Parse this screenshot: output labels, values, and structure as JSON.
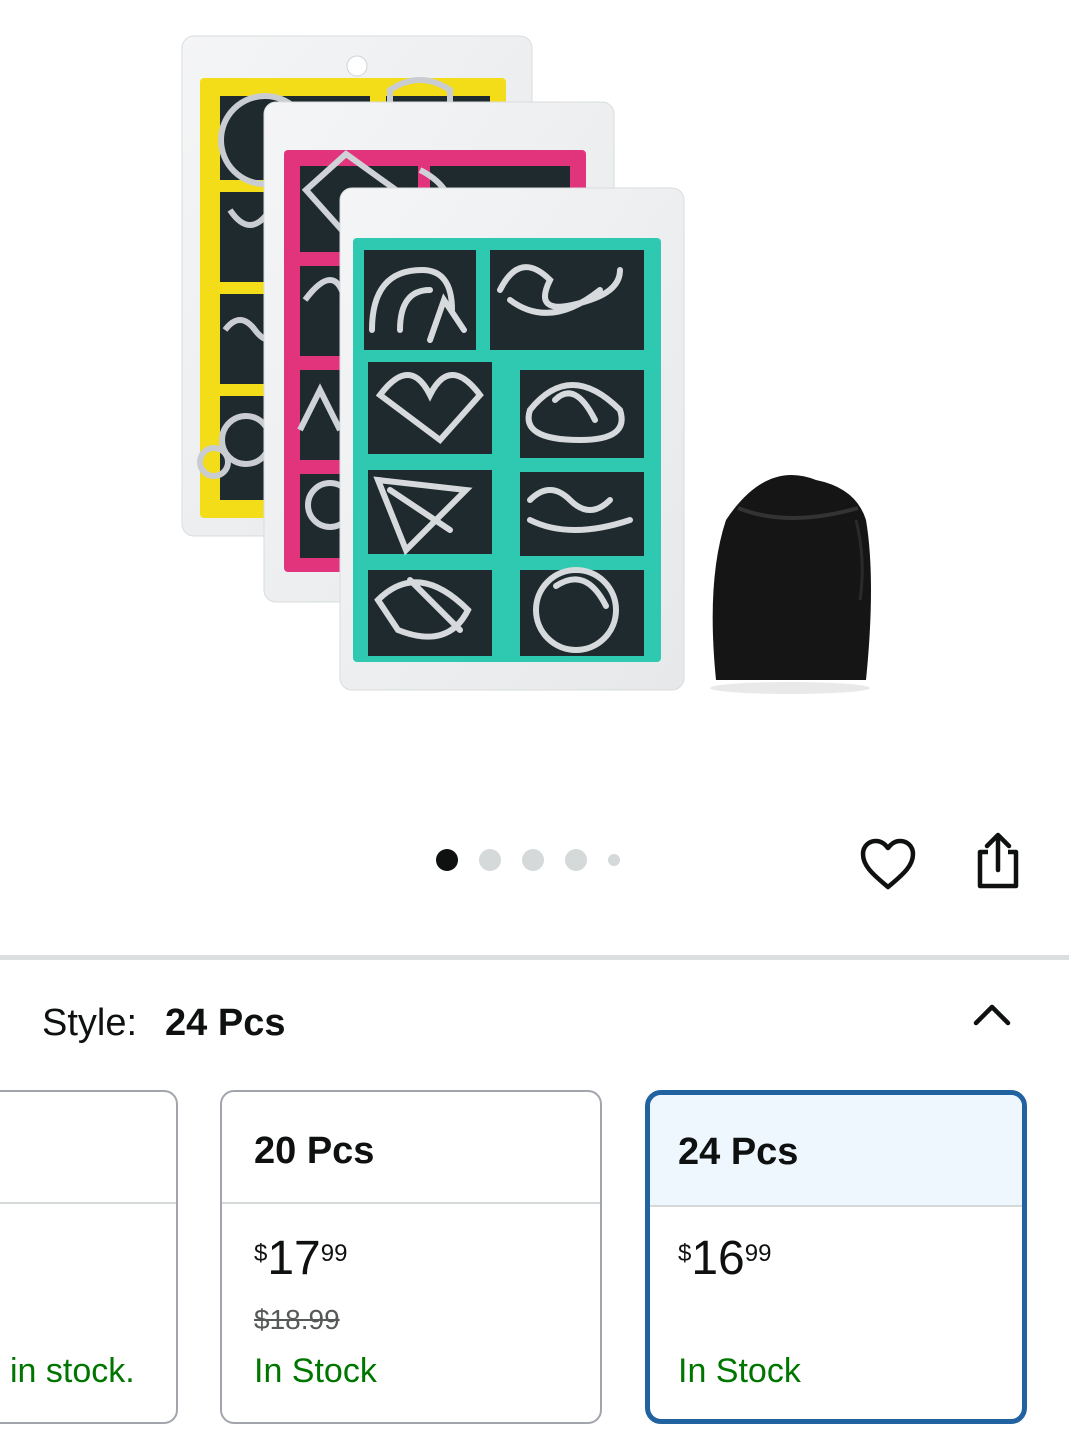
{
  "gallery": {
    "image_alt": "Metal wire puzzle sets in yellow, pink and teal cards with a black drawstring bag",
    "dot_count": 5,
    "active_index": 0
  },
  "actions": {
    "wishlist_icon": "heart-icon",
    "share_icon": "share-icon"
  },
  "style_selector": {
    "label": "Style:",
    "value": "24 Pcs",
    "collapse_icon": "chevron-up-icon"
  },
  "options": [
    {
      "name": "",
      "stock": "in stock."
    },
    {
      "name": "20 Pcs",
      "price_currency": "$",
      "price_whole": "17",
      "price_fraction": "99",
      "was_price": "$18.99",
      "stock": "In Stock"
    },
    {
      "name": "24 Pcs",
      "price_currency": "$",
      "price_whole": "16",
      "price_fraction": "99",
      "stock": "In Stock",
      "selected": true
    }
  ],
  "colors": {
    "selected_border": "#2162a1",
    "selected_header_bg": "#edf7fd",
    "in_stock": "#007600"
  }
}
